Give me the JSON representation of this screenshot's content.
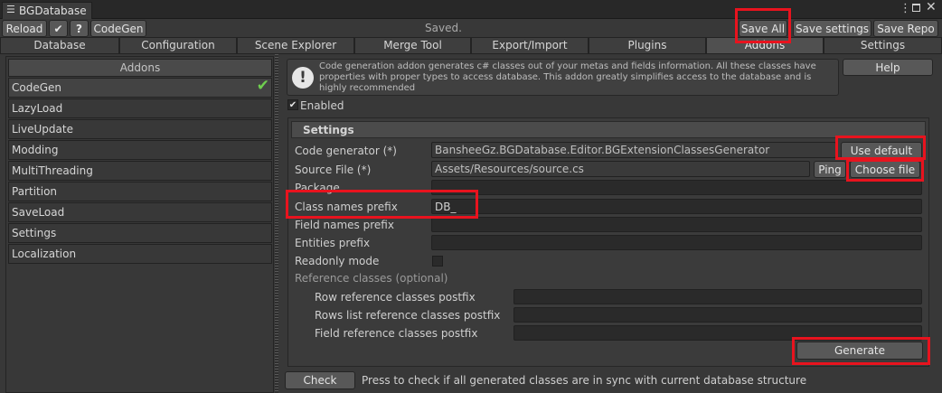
{
  "window": {
    "title": "BGDatabase"
  },
  "toolbar": {
    "reload": "Reload",
    "codegen": "CodeGen",
    "status": "Saved.",
    "save_all": "Save All",
    "save_settings": "Save settings",
    "save_repo": "Save Repo"
  },
  "tabs": [
    "Database",
    "Configuration",
    "Scene Explorer",
    "Merge Tool",
    "Export/Import",
    "Plugins",
    "Addons",
    "Settings"
  ],
  "addons": {
    "header": "Addons",
    "items": [
      "CodeGen",
      "LazyLoad",
      "LiveUpdate",
      "Modding",
      "MultiThreading",
      "Partition",
      "SaveLoad",
      "Settings",
      "Localization"
    ],
    "selected": "CodeGen"
  },
  "codegen": {
    "info": "Code generation addon generates c# classes out of your metas and fields information. All these classes have properties with proper types to access database. This addon greatly simplifies access to the database and is highly recommended",
    "help": "Help",
    "enabled_label": "Enabled",
    "settings_header": "Settings",
    "code_generator": {
      "label": "Code generator (*)",
      "value": "BansheeGz.BGDatabase.Editor.BGExtensionClassesGenerator",
      "button": "Use default"
    },
    "source_file": {
      "label": "Source File (*)",
      "value": "Assets/Resources/source.cs",
      "ping": "Ping",
      "choose": "Choose file"
    },
    "package": {
      "label": "Package",
      "value": ""
    },
    "class_prefix": {
      "label": "Class names prefix",
      "value": "DB_"
    },
    "field_prefix": {
      "label": "Field names prefix",
      "value": ""
    },
    "entities_prefix": {
      "label": "Entities prefix",
      "value": ""
    },
    "readonly_label": "Readonly mode",
    "reference_header": "Reference classes (optional)",
    "row_ref": {
      "label": "Row reference classes postfix",
      "value": ""
    },
    "rows_list_ref": {
      "label": "Rows list reference classes postfix",
      "value": ""
    },
    "field_ref": {
      "label": "Field reference classes postfix",
      "value": ""
    },
    "generate": "Generate",
    "check": "Check",
    "check_hint": "Press to check if all generated classes are in sync with current database structure"
  },
  "colors": {
    "highlight": "#e8131e",
    "check_green": "#6fcf4f"
  }
}
